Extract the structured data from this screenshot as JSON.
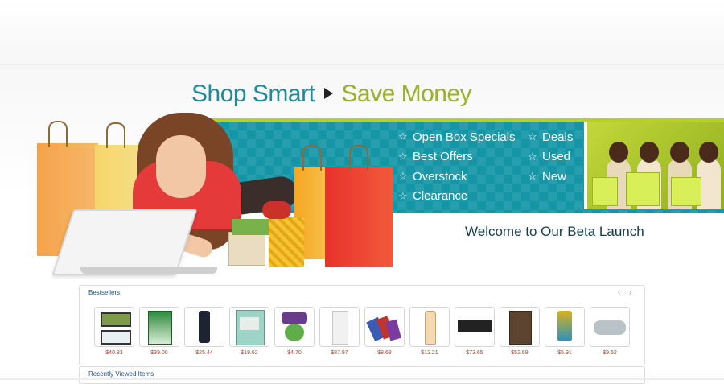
{
  "banner": {
    "tagline_part1": "Shop Smart",
    "tagline_part2": "Save Money",
    "offers_left": [
      "Open Box Specials",
      "Best Offers",
      "Overstock",
      "Clearance"
    ],
    "offers_right": [
      "Deals",
      "Used",
      "New"
    ],
    "welcome": "Welcome to Our Beta Launch",
    "colors": {
      "teal": "#1596a6",
      "lime": "#9ab228",
      "dark_teal": "#143d52"
    }
  },
  "bestsellers": {
    "title": "Bestsellers",
    "prev_icon": "chevron-left-icon",
    "next_icon": "chevron-right-icon",
    "products": [
      {
        "price": "$40.83"
      },
      {
        "price": "$39.00"
      },
      {
        "price": "$25.44"
      },
      {
        "price": "$19.62"
      },
      {
        "price": "$4.70"
      },
      {
        "price": "$87.97"
      },
      {
        "price": "$8.68"
      },
      {
        "price": "$12.21"
      },
      {
        "price": "$73.65"
      },
      {
        "price": "$52.69"
      },
      {
        "price": "$5.91"
      },
      {
        "price": "$9.62"
      }
    ]
  },
  "recently_viewed": {
    "title": "Recently Viewed Items"
  }
}
